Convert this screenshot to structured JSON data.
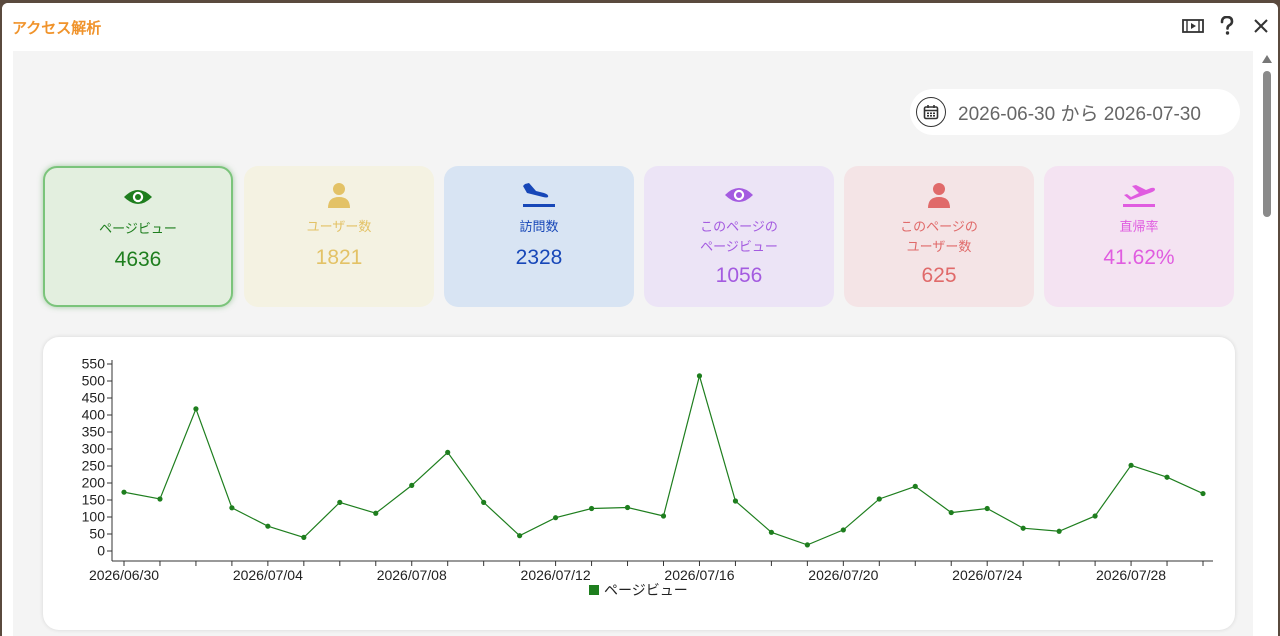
{
  "window": {
    "title": "アクセス解析",
    "title_color": "#f0932b",
    "icons": [
      "video-icon",
      "help-icon",
      "close-icon"
    ]
  },
  "date_filter": {
    "icon": "calendar-icon",
    "text": "2026-06-30 から 2026-07-30"
  },
  "cards": [
    {
      "label": "ページビュー",
      "value": "4636",
      "color": "#1e7e1e",
      "bg": "#e3efdf",
      "icon": "eye-icon",
      "selected": true
    },
    {
      "label": "ユーザー数",
      "value": "1821",
      "color": "#e3c266",
      "bg": "#f4f2e2",
      "icon": "user-icon"
    },
    {
      "label": "訪問数",
      "value": "2328",
      "color": "#1747b8",
      "bg": "#d8e4f3",
      "icon": "plane-landing-icon"
    },
    {
      "label_lines": [
        "このページの",
        "ページビュー"
      ],
      "value": "1056",
      "color": "#a45be0",
      "bg": "#ece4f6",
      "icon": "eye-icon"
    },
    {
      "label_lines": [
        "このページの",
        "ユーザー数"
      ],
      "value": "625",
      "color": "#e06a6a",
      "bg": "#f4e4e6",
      "icon": "user-icon"
    },
    {
      "label": "直帰率",
      "value": "41.62%",
      "color": "#e05ce0",
      "bg": "#f4e3f2",
      "icon": "plane-takeoff-icon"
    }
  ],
  "chart_data": {
    "type": "line",
    "series": [
      {
        "name": "ページビュー",
        "color": "#1e7e1e",
        "x": [
          "2026/06/30",
          "2026/07/01",
          "2026/07/02",
          "2026/07/03",
          "2026/07/04",
          "2026/07/05",
          "2026/07/06",
          "2026/07/07",
          "2026/07/08",
          "2026/07/09",
          "2026/07/10",
          "2026/07/11",
          "2026/07/12",
          "2026/07/13",
          "2026/07/14",
          "2026/07/15",
          "2026/07/16",
          "2026/07/17",
          "2026/07/18",
          "2026/07/19",
          "2026/07/20",
          "2026/07/21",
          "2026/07/22",
          "2026/07/23",
          "2026/07/24",
          "2026/07/25",
          "2026/07/26",
          "2026/07/27",
          "2026/07/28",
          "2026/07/29",
          "2026/07/30"
        ],
        "values": [
          173,
          153,
          418,
          127,
          73,
          40,
          143,
          111,
          193,
          290,
          143,
          45,
          98,
          125,
          128,
          103,
          515,
          147,
          55,
          18,
          62,
          153,
          190,
          113,
          125,
          67,
          58,
          103,
          252,
          217,
          169
        ]
      }
    ],
    "x_tick_labels": [
      "2026/06/30",
      "2026/07/04",
      "2026/07/08",
      "2026/07/12",
      "2026/07/16",
      "2026/07/20",
      "2026/07/24",
      "2026/07/28"
    ],
    "y_ticks": [
      0,
      50,
      100,
      150,
      200,
      250,
      300,
      350,
      400,
      450,
      500,
      550
    ],
    "ylim": [
      0,
      550
    ],
    "legend_position": "bottom-center",
    "grid": false
  }
}
